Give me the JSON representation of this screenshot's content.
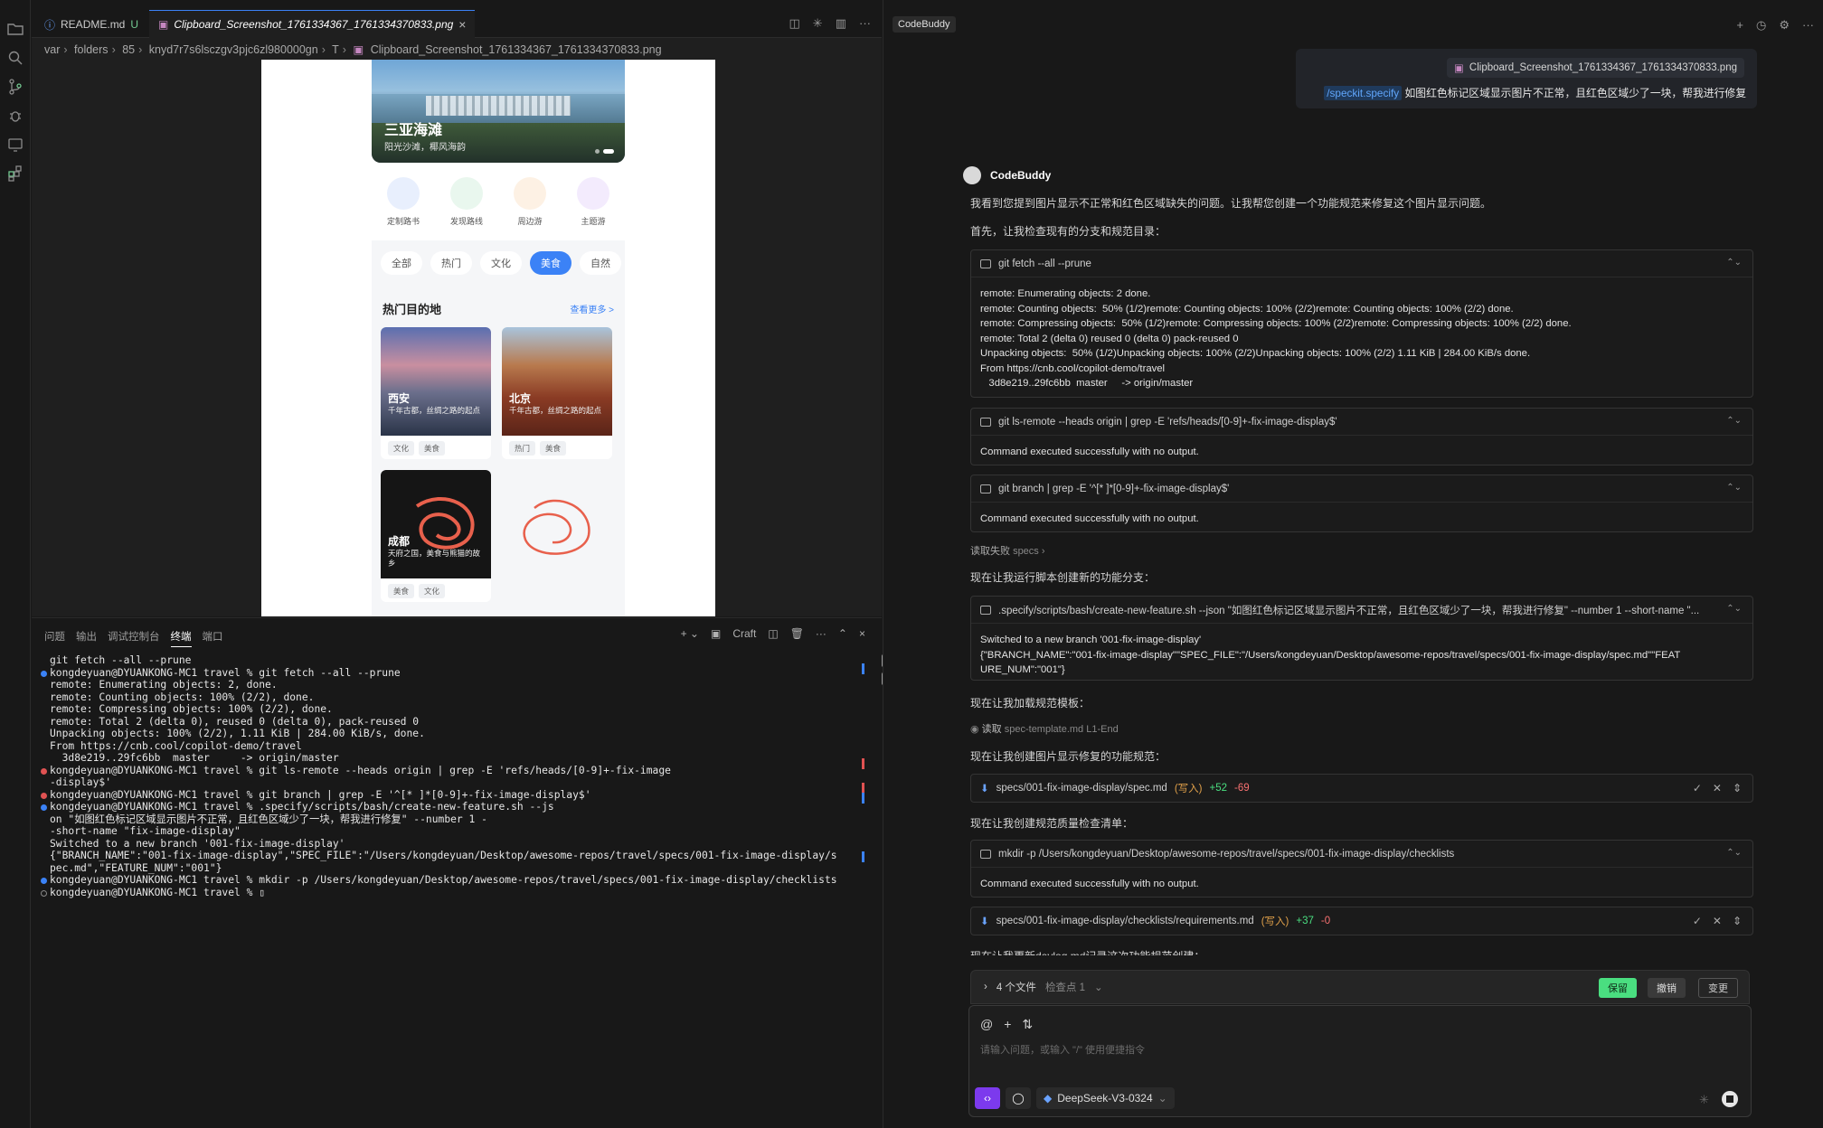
{
  "editor": {
    "tabs": [
      {
        "label": "README.md",
        "status": "U"
      },
      {
        "label": "Clipboard_Screenshot_1761334367_1761334370833.png"
      }
    ],
    "breadcrumb": [
      "var",
      "folders",
      "85",
      "knyd7r7s6lsczgv3pjc6zl980000gn",
      "T",
      "Clipboard_Screenshot_1761334367_1761334370833.png"
    ]
  },
  "preview": {
    "hero_title": "三亚海滩",
    "hero_sub": "阳光沙滩，椰风海韵",
    "categories": [
      "定制路书",
      "发现路线",
      "周边游",
      "主题游"
    ],
    "filters": [
      "全部",
      "热门",
      "文化",
      "美食",
      "自然"
    ],
    "section_title": "热门目的地",
    "section_more": "查看更多 >",
    "cards": [
      {
        "title": "西安",
        "desc": "千年古都，丝绸之路的起点",
        "tags": [
          "文化",
          "美食"
        ]
      },
      {
        "title": "北京",
        "desc": "千年古都，丝绸之路的起点",
        "tags": [
          "热门",
          "美食"
        ]
      },
      {
        "title": "成都",
        "desc": "天府之国，美食与熊猫的故乡",
        "tags": [
          "美食",
          "文化"
        ]
      }
    ]
  },
  "panel": {
    "tabs": [
      "问题",
      "输出",
      "调试控制台",
      "终端",
      "端口"
    ],
    "active_tab": "终端",
    "craft_label": "Craft",
    "lines": [
      {
        "t": "git fetch --all --prune",
        "d": ""
      },
      {
        "t": "kongdeyuan@DYUANKONG-MC1 travel % git fetch --all --prune",
        "d": "blue"
      },
      {
        "t": "remote: Enumerating objects: 2, done.",
        "d": ""
      },
      {
        "t": "remote: Counting objects: 100% (2/2), done.",
        "d": ""
      },
      {
        "t": "remote: Compressing objects: 100% (2/2), done.",
        "d": ""
      },
      {
        "t": "remote: Total 2 (delta 0), reused 0 (delta 0), pack-reused 0",
        "d": ""
      },
      {
        "t": "Unpacking objects: 100% (2/2), 1.11 KiB | 284.00 KiB/s, done.",
        "d": ""
      },
      {
        "t": "From https://cnb.cool/copilot-demo/travel",
        "d": ""
      },
      {
        "t": "  3d8e219..29fc6bb  master     -> origin/master",
        "d": ""
      },
      {
        "t": "kongdeyuan@DYUANKONG-MC1 travel % git ls-remote --heads origin | grep -E 'refs/heads/[0-9]+-fix-image",
        "d": "red"
      },
      {
        "t": "-display$'",
        "d": ""
      },
      {
        "t": "kongdeyuan@DYUANKONG-MC1 travel % git branch | grep -E '^[* ]*[0-9]+-fix-image-display$'",
        "d": "red"
      },
      {
        "t": "kongdeyuan@DYUANKONG-MC1 travel % .specify/scripts/bash/create-new-feature.sh --js",
        "d": "blue"
      },
      {
        "t": "on \"如图红色标记区域显示图片不正常，且红色区域少了一块，帮我进行修复\" --number 1 -",
        "d": ""
      },
      {
        "t": "-short-name \"fix-image-display\"",
        "d": ""
      },
      {
        "t": "Switched to a new branch '001-fix-image-display'",
        "d": ""
      },
      {
        "t": "{\"BRANCH_NAME\":\"001-fix-image-display\",\"SPEC_FILE\":\"/Users/kongdeyuan/Desktop/awesome-repos/travel/specs/001-fix-image-display/s",
        "d": ""
      },
      {
        "t": "pec.md\",\"FEATURE_NUM\":\"001\"}",
        "d": ""
      },
      {
        "t": "kongdeyuan@DYUANKONG-MC1 travel % mkdir -p /Users/kongdeyuan/Desktop/awesome-repos/travel/specs/001-fix-image-display/checklists",
        "d": "blue"
      },
      {
        "t": "kongdeyuan@DYUANKONG-MC1 travel % ▯",
        "d": "gray"
      }
    ]
  },
  "codebuddy": {
    "title": "CodeBuddy",
    "attachment": "Clipboard_Screenshot_1761334367_1761334370833.png",
    "user_command": "/speckit.specify",
    "user_text": "如图红色标记区域显示图片不正常，且红色区域少了一块，帮我进行修复",
    "bot_name": "CodeBuddy",
    "p1": "我看到您提到图片显示不正常和红色区域缺失的问题。让我帮您创建一个功能规范来修复这个图片显示问题。",
    "p2": "首先，让我检查现有的分支和规范目录：",
    "cmd1": "git fetch --all --prune",
    "cmd1_out": "remote: Enumerating objects: 2 done.\nremote: Counting objects:  50% (1/2)remote: Counting objects: 100% (2/2)remote: Counting objects: 100% (2/2) done.\nremote: Compressing objects:  50% (1/2)remote: Compressing objects: 100% (2/2)remote: Compressing objects: 100% (2/2) done.\nremote: Total 2 (delta 0) reused 0 (delta 0) pack-reused 0\nUnpacking objects:  50% (1/2)Unpacking objects: 100% (2/2)Unpacking objects: 100% (2/2) 1.11 KiB | 284.00 KiB/s done.\nFrom https://cnb.cool/copilot-demo/travel\n   3d8e219..29fc6bb  master     -> origin/master",
    "cmd2": "git ls-remote --heads origin | grep -E 'refs/heads/[0-9]+-fix-image-display$'",
    "cmd2_out": "Command executed successfully with no output.",
    "cmd3": "git branch | grep -E '^[* ]*[0-9]+-fix-image-display$'",
    "cmd3_out": "Command executed successfully with no output.",
    "read_fail": "读取失败",
    "read_fail_target": "specs",
    "p3": "现在让我运行脚本创建新的功能分支：",
    "cmd4": ".specify/scripts/bash/create-new-feature.sh --json \"如图红色标记区域显示图片不正常，且红色区域少了一块，帮我进行修复\" --number 1 --short-name \"...",
    "cmd4_out": "Switched to a new branch '001-fix-image-display'\n{\"BRANCH_NAME\":\"001-fix-image-display\"\"SPEC_FILE\":\"/Users/kongdeyuan/Desktop/awesome-repos/travel/specs/001-fix-image-display/spec.md\"\"FEAT\nURE_NUM\":\"001\"}",
    "p4": "现在让我加载规范模板：",
    "read_label": "读取",
    "read_target": "spec-template.md L1-End",
    "p5": "现在让我创建图片显示修复的功能规范：",
    "file1": "specs/001-fix-image-display/spec.md",
    "file1_tag": "(写入)",
    "file1_add": "+52",
    "file1_del": "-69",
    "p6": "现在让我创建规范质量检查清单：",
    "cmd5": "mkdir -p /Users/kongdeyuan/Desktop/awesome-repos/travel/specs/001-fix-image-display/checklists",
    "cmd5_out": "Command executed successfully with no output.",
    "file2": "specs/001-fix-image-display/checklists/requirements.md",
    "file2_tag": "(写入)",
    "file2_add": "+37",
    "file2_del": "-0",
    "p7": "现在让我更新devlog.md记录这次功能规范创建：",
    "changes_label": "4 个文件",
    "checkpoint_label": "检查点 1",
    "keep_label": "保留",
    "undo_label": "撤销",
    "changes_btn": "变更",
    "input_placeholder": "请输入问题，或输入 \"/\" 使用便捷指令",
    "model": "DeepSeek-V3-0324"
  },
  "colors": {
    "accent": "#3b82f6",
    "keep": "#4ade80",
    "purple": "#7c3aed"
  }
}
